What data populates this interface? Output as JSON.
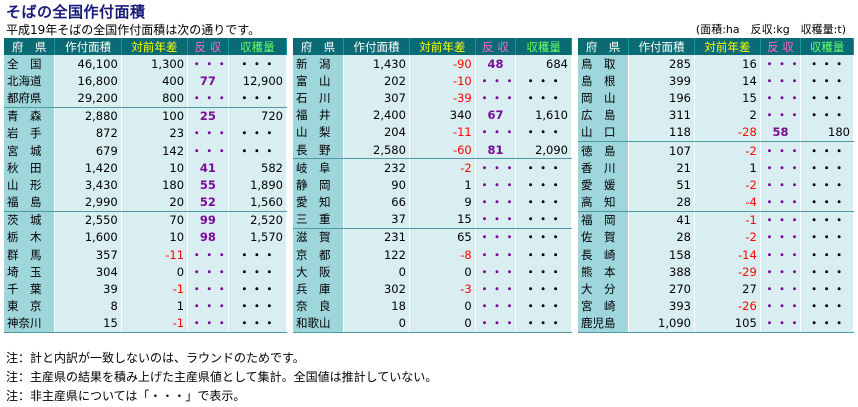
{
  "title": "そばの全国作付面積",
  "subtitle": "平成19年そばの全国作付面積は次の通りです。",
  "units": "(面積:ha　反収:kg　収穫量:t)",
  "headers": {
    "pref": "府　県",
    "area": "作付面積",
    "diff": "対前年差",
    "yield": "反 収",
    "harvest": "収穫量"
  },
  "blocks": [
    {
      "rows": [
        {
          "pref": "全　国",
          "area": "46,100",
          "diff": "1,300",
          "yield": "・・・",
          "harvest": "・・・"
        },
        {
          "pref": "北海道",
          "area": "16,800",
          "diff": "400",
          "yield": "77",
          "harvest": "12,900"
        },
        {
          "pref": "都府県",
          "area": "29,200",
          "diff": "800",
          "yield": "・・・",
          "harvest": "・・・"
        },
        {
          "pref": "青　森",
          "area": "2,880",
          "diff": "100",
          "yield": "25",
          "harvest": "720"
        },
        {
          "pref": "岩　手",
          "area": "872",
          "diff": "23",
          "yield": "・・・",
          "harvest": "・・・"
        },
        {
          "pref": "宮　城",
          "area": "679",
          "diff": "142",
          "yield": "・・・",
          "harvest": "・・・"
        },
        {
          "pref": "秋　田",
          "area": "1,420",
          "diff": "10",
          "yield": "41",
          "harvest": "582"
        },
        {
          "pref": "山　形",
          "area": "3,430",
          "diff": "180",
          "yield": "55",
          "harvest": "1,890"
        },
        {
          "pref": "福　島",
          "area": "2,990",
          "diff": "20",
          "yield": "52",
          "harvest": "1,560"
        },
        {
          "pref": "茨　城",
          "area": "2,550",
          "diff": "70",
          "yield": "99",
          "harvest": "2,520"
        },
        {
          "pref": "栃　木",
          "area": "1,600",
          "diff": "10",
          "yield": "98",
          "harvest": "1,570"
        },
        {
          "pref": "群　馬",
          "area": "357",
          "diff": "-11",
          "yield": "・・・",
          "harvest": "・・・"
        },
        {
          "pref": "埼　玉",
          "area": "304",
          "diff": "0",
          "yield": "・・・",
          "harvest": "・・・"
        },
        {
          "pref": "千　葉",
          "area": "39",
          "diff": "-1",
          "yield": "・・・",
          "harvest": "・・・"
        },
        {
          "pref": "東　京",
          "area": "8",
          "diff": "1",
          "yield": "・・・",
          "harvest": "・・・"
        },
        {
          "pref": "神奈川",
          "area": "15",
          "diff": "-1",
          "yield": "・・・",
          "harvest": "・・・"
        }
      ]
    },
    {
      "rows": [
        {
          "pref": "新　潟",
          "area": "1,430",
          "diff": "-90",
          "yield": "48",
          "harvest": "684"
        },
        {
          "pref": "富　山",
          "area": "202",
          "diff": "-10",
          "yield": "・・・",
          "harvest": "・・・"
        },
        {
          "pref": "石　川",
          "area": "307",
          "diff": "-39",
          "yield": "・・・",
          "harvest": "・・・"
        },
        {
          "pref": "福　井",
          "area": "2,400",
          "diff": "340",
          "yield": "67",
          "harvest": "1,610"
        },
        {
          "pref": "山　梨",
          "area": "204",
          "diff": "-11",
          "yield": "・・・",
          "harvest": "・・・"
        },
        {
          "pref": "長　野",
          "area": "2,580",
          "diff": "-60",
          "yield": "81",
          "harvest": "2,090"
        },
        {
          "pref": "岐　阜",
          "area": "232",
          "diff": "-2",
          "yield": "・・・",
          "harvest": "・・・"
        },
        {
          "pref": "静　岡",
          "area": "90",
          "diff": "1",
          "yield": "・・・",
          "harvest": "・・・"
        },
        {
          "pref": "愛　知",
          "area": "66",
          "diff": "9",
          "yield": "・・・",
          "harvest": "・・・"
        },
        {
          "pref": "三　重",
          "area": "37",
          "diff": "15",
          "yield": "・・・",
          "harvest": "・・・"
        },
        {
          "pref": "滋　賀",
          "area": "231",
          "diff": "65",
          "yield": "・・・",
          "harvest": "・・・"
        },
        {
          "pref": "京　都",
          "area": "122",
          "diff": "-8",
          "yield": "・・・",
          "harvest": "・・・"
        },
        {
          "pref": "大　阪",
          "area": "0",
          "diff": "0",
          "yield": "・・・",
          "harvest": "・・・"
        },
        {
          "pref": "兵　庫",
          "area": "302",
          "diff": "-3",
          "yield": "・・・",
          "harvest": "・・・"
        },
        {
          "pref": "奈　良",
          "area": "18",
          "diff": "0",
          "yield": "・・・",
          "harvest": "・・・"
        },
        {
          "pref": "和歌山",
          "area": "0",
          "diff": "0",
          "yield": "・・・",
          "harvest": "・・・"
        }
      ]
    },
    {
      "rows": [
        {
          "pref": "鳥　取",
          "area": "285",
          "diff": "16",
          "yield": "・・・",
          "harvest": "・・・"
        },
        {
          "pref": "島　根",
          "area": "399",
          "diff": "14",
          "yield": "・・・",
          "harvest": "・・・"
        },
        {
          "pref": "岡　山",
          "area": "196",
          "diff": "15",
          "yield": "・・・",
          "harvest": "・・・"
        },
        {
          "pref": "広　島",
          "area": "311",
          "diff": "2",
          "yield": "・・・",
          "harvest": "・・・"
        },
        {
          "pref": "山　口",
          "area": "118",
          "diff": "-28",
          "yield": "58",
          "harvest": "180"
        },
        {
          "pref": "徳　島",
          "area": "107",
          "diff": "-2",
          "yield": "・・・",
          "harvest": "・・・"
        },
        {
          "pref": "香　川",
          "area": "21",
          "diff": "1",
          "yield": "・・・",
          "harvest": "・・・"
        },
        {
          "pref": "愛　媛",
          "area": "51",
          "diff": "-2",
          "yield": "・・・",
          "harvest": "・・・"
        },
        {
          "pref": "高　知",
          "area": "28",
          "diff": "-4",
          "yield": "・・・",
          "harvest": "・・・"
        },
        {
          "pref": "福　岡",
          "area": "41",
          "diff": "-1",
          "yield": "・・・",
          "harvest": "・・・"
        },
        {
          "pref": "佐　賀",
          "area": "28",
          "diff": "-2",
          "yield": "・・・",
          "harvest": "・・・"
        },
        {
          "pref": "長　崎",
          "area": "158",
          "diff": "-14",
          "yield": "・・・",
          "harvest": "・・・"
        },
        {
          "pref": "熊　本",
          "area": "388",
          "diff": "-29",
          "yield": "・・・",
          "harvest": "・・・"
        },
        {
          "pref": "大　分",
          "area": "270",
          "diff": "27",
          "yield": "・・・",
          "harvest": "・・・"
        },
        {
          "pref": "宮　崎",
          "area": "393",
          "diff": "-26",
          "yield": "・・・",
          "harvest": "・・・"
        },
        {
          "pref": "鹿児島",
          "area": "1,090",
          "diff": "105",
          "yield": "・・・",
          "harvest": "・・・"
        }
      ]
    }
  ],
  "notes": [
    "注：計と内訳が一致しないのは、ラウンドのためです。",
    "注：主産県の結果を積み上げた主産県値として集計。全国値は推計していない。",
    "注：非主産県については「・・・」で表示。"
  ],
  "colors": {
    "header_bg": "#0b6b74",
    "pref_bg": "#9ed6dc",
    "cell_bg": "#d8eef0",
    "negative": "#ff0000",
    "yield": "#7a0a98"
  }
}
